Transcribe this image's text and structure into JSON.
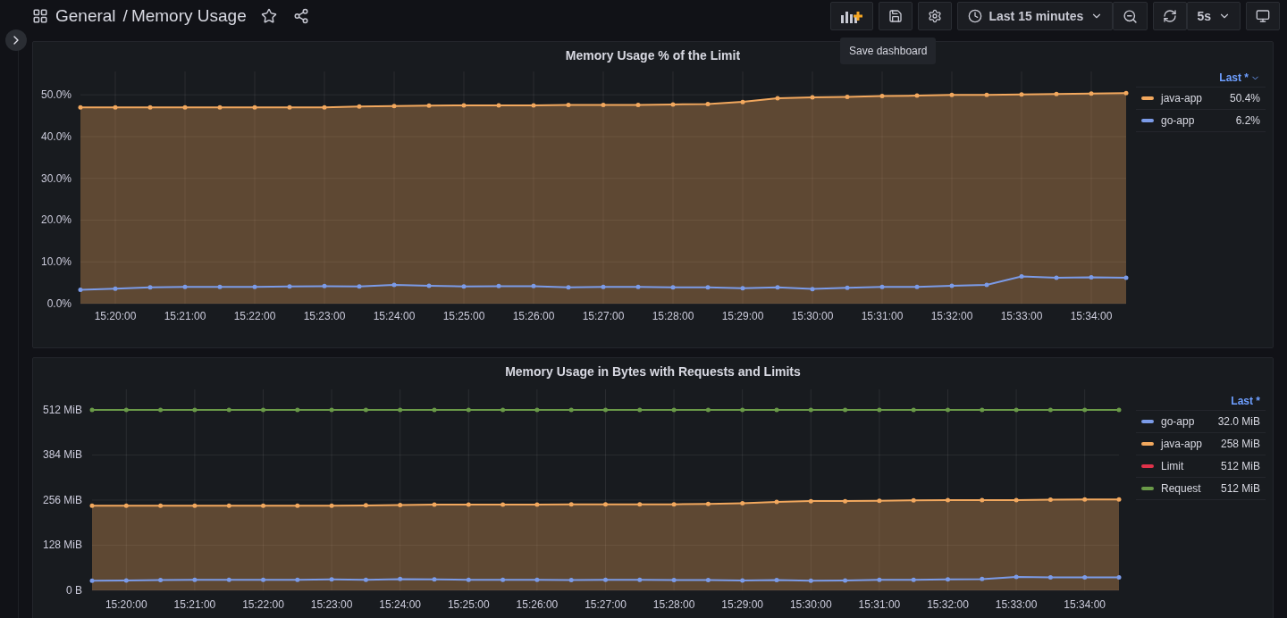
{
  "breadcrumb": {
    "folder": "General",
    "separator": "/",
    "title": "Memory Usage"
  },
  "toolbar": {
    "time_range": "Last 15 minutes",
    "refresh_interval": "5s"
  },
  "tooltip": "Save dashboard",
  "panels": [
    {
      "title": "Memory Usage % of the Limit",
      "legend_header": {
        "label": "Last *",
        "sort_caret": true
      },
      "legend_values": [
        "50.4%",
        "6.2%"
      ],
      "chart_data": {
        "type": "line",
        "grid": true,
        "categories": [
          null,
          "15:20:00",
          null,
          "15:21:00",
          null,
          "15:22:00",
          null,
          "15:23:00",
          null,
          "15:24:00",
          null,
          "15:25:00",
          null,
          "15:26:00",
          null,
          "15:27:00",
          null,
          "15:28:00",
          null,
          "15:29:00",
          null,
          "15:30:00",
          null,
          "15:31:00",
          null,
          "15:32:00",
          null,
          "15:33:00",
          null,
          "15:34:00",
          null
        ],
        "ylim": [
          0,
          55.6
        ],
        "yticks": [
          {
            "value": 0,
            "label": "0.0%"
          },
          {
            "value": 10,
            "label": "10.0%"
          },
          {
            "value": 20,
            "label": "20.0%"
          },
          {
            "value": 30,
            "label": "30.0%"
          },
          {
            "value": 40,
            "label": "40.0%"
          },
          {
            "value": 50,
            "label": "50.0%"
          }
        ],
        "series": [
          {
            "name": "java-app",
            "color": "#f2a85e",
            "type": "area",
            "values": [
              47.0,
              47.0,
              47.0,
              47.0,
              47.0,
              47.0,
              47.0,
              47.0,
              47.2,
              47.3,
              47.4,
              47.5,
              47.5,
              47.5,
              47.6,
              47.6,
              47.6,
              47.7,
              47.8,
              48.3,
              49.2,
              49.4,
              49.5,
              49.7,
              49.8,
              50.0,
              50.0,
              50.1,
              50.2,
              50.3,
              50.4
            ]
          },
          {
            "name": "go-app",
            "color": "#7b9be8",
            "values": [
              3.3,
              3.6,
              3.9,
              4.0,
              4.0,
              4.0,
              4.1,
              4.2,
              4.1,
              4.5,
              4.3,
              4.1,
              4.2,
              4.2,
              3.9,
              4.0,
              4.0,
              3.9,
              3.9,
              3.7,
              3.9,
              3.5,
              3.8,
              4.0,
              4.0,
              4.3,
              4.5,
              6.5,
              6.2,
              6.3,
              6.2
            ]
          }
        ]
      }
    },
    {
      "title": "Memory Usage in Bytes with Requests and Limits",
      "legend_header": {
        "label": "Last *",
        "sort_caret": false
      },
      "legend_values": [
        "32.0 MiB",
        "258 MiB",
        "512 MiB",
        "512 MiB"
      ],
      "chart_data": {
        "type": "line",
        "grid": true,
        "categories": [
          null,
          "15:20:00",
          null,
          "15:21:00",
          null,
          "15:22:00",
          null,
          "15:23:00",
          null,
          "15:24:00",
          null,
          "15:25:00",
          null,
          "15:26:00",
          null,
          "15:27:00",
          null,
          "15:28:00",
          null,
          "15:29:00",
          null,
          "15:30:00",
          null,
          "15:31:00",
          null,
          "15:32:00",
          null,
          "15:33:00",
          null,
          "15:34:00",
          null
        ],
        "ylim": [
          0,
          570
        ],
        "yticks": [
          {
            "value": 0,
            "label": "0 B"
          },
          {
            "value": 128,
            "label": "128 MiB"
          },
          {
            "value": 256,
            "label": "256 MiB"
          },
          {
            "value": 384,
            "label": "384 MiB"
          },
          {
            "value": 512,
            "label": "512 MiB"
          }
        ],
        "series": [
          {
            "name": "go-app",
            "color": "#7b9be8",
            "values": [
              27,
              28,
              29,
              30,
              30,
              30,
              30,
              31,
              30,
              32,
              31,
              30,
              30,
              30,
              29,
              30,
              30,
              29,
              29,
              28,
              29,
              27,
              28,
              30,
              30,
              31,
              32,
              38,
              37,
              37,
              37
            ]
          },
          {
            "name": "java-app",
            "color": "#f2a85e",
            "type": "area",
            "values": [
              240,
              240,
              240,
              240,
              240,
              240,
              240,
              240,
              241,
              242,
              243,
              243,
              243,
              243,
              244,
              244,
              244,
              244,
              245,
              247,
              251,
              253,
              253,
              254,
              255,
              256,
              256,
              256,
              257,
              258,
              258
            ]
          },
          {
            "name": "Limit",
            "color": "#e0324a",
            "values": [
              null,
              null,
              null,
              null,
              null,
              null,
              null,
              null,
              null,
              null,
              null,
              null,
              null,
              null,
              null,
              null,
              null,
              null,
              null,
              null,
              null,
              null,
              null,
              null,
              null,
              null,
              null,
              null,
              null,
              null,
              null
            ]
          },
          {
            "name": "Request",
            "color": "#6a9a48",
            "values": [
              512,
              512,
              512,
              512,
              512,
              512,
              512,
              512,
              512,
              512,
              512,
              512,
              512,
              512,
              512,
              512,
              512,
              512,
              512,
              512,
              512,
              512,
              512,
              512,
              512,
              512,
              512,
              512,
              512,
              512,
              512
            ]
          }
        ]
      }
    }
  ]
}
